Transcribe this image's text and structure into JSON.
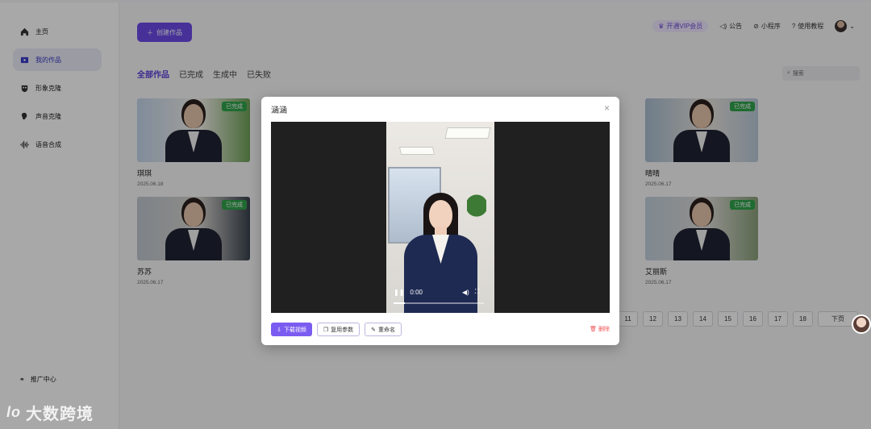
{
  "sidebar": {
    "items": [
      {
        "label": "主页",
        "icon": "home-icon"
      },
      {
        "label": "我的作品",
        "icon": "video-icon",
        "active": true
      },
      {
        "label": "形象克隆",
        "icon": "mask-icon"
      },
      {
        "label": "声音克隆",
        "icon": "voice-icon"
      },
      {
        "label": "语音合成",
        "icon": "waveform-icon"
      }
    ],
    "bottom_label": "推广中心"
  },
  "header": {
    "create_label": "创建作品",
    "vip_label": "开通VIP会员",
    "announcement": "公告",
    "mini_program": "小程序",
    "tutorial": "使用教程"
  },
  "tabs": [
    "全部作品",
    "已完成",
    "生成中",
    "已失败"
  ],
  "search": {
    "placeholder": "搜索"
  },
  "cards": [
    {
      "name": "琪琪",
      "date": "2025.06.18",
      "status": "已完成"
    },
    {
      "name": "晴晴",
      "date": "2025.06.17",
      "status": "已完成"
    },
    {
      "name": "苏苏",
      "date": "2025.06.17",
      "status": "已完成"
    },
    {
      "name": "艾丽斯",
      "date": "2025.06.17",
      "status": "已完成"
    }
  ],
  "pagination": {
    "pages": [
      "11",
      "12",
      "13",
      "14",
      "15",
      "16",
      "17",
      "18"
    ],
    "next": "下页"
  },
  "modal": {
    "title": "涵涵",
    "time": "0:00",
    "download": "下载视频",
    "reuse": "复用参数",
    "rename": "重命名",
    "delete": "删除"
  },
  "watermark": {
    "logo": "lo",
    "text": "大数跨境"
  },
  "colors": {
    "accent": "#6c4be8",
    "success": "#2fa34b",
    "danger": "#e55555"
  }
}
